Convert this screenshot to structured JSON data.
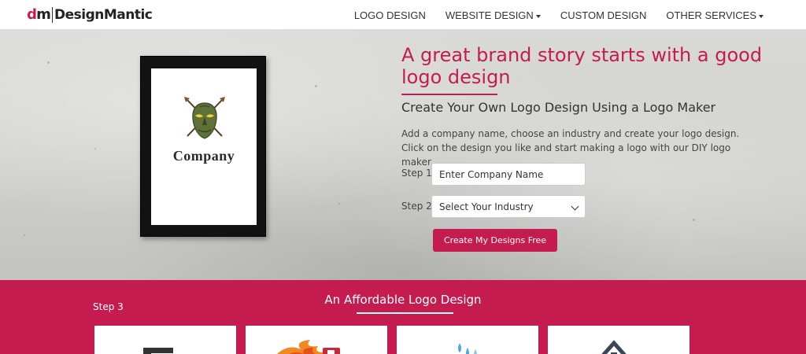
{
  "brand": {
    "mark_d": "d",
    "mark_m": "m",
    "name": "DesignMantic",
    "accent_color": "#c41c4e"
  },
  "nav": {
    "items": [
      {
        "label": "LOGO DESIGN",
        "dropdown": false
      },
      {
        "label": "WEBSITE DESIGN",
        "dropdown": true
      },
      {
        "label": "CUSTOM DESIGN",
        "dropdown": false
      },
      {
        "label": "OTHER SERVICES",
        "dropdown": true
      }
    ]
  },
  "hero": {
    "title": "A great brand story starts with a good logo design",
    "subtitle": "Create Your Own Logo Design Using a Logo Maker",
    "description": "Add a company name, choose an industry and create your logo design. Click on the design you like and start making a logo with our DIY logo maker.",
    "frame_logo_text": "Company",
    "step1_label": "Step 1",
    "company_placeholder": "Enter Company Name",
    "step2_label": "Step 2",
    "industry_selected": "Select Your Industry",
    "cta_label": "Create My Designs Free"
  },
  "band": {
    "step_label": "Step 3",
    "title": "An Affordable Logo Design"
  },
  "cards": [
    {
      "icon": "block-logo-icon"
    },
    {
      "icon": "flame-truck-logo-icon"
    },
    {
      "icon": "water-drops-logo-icon"
    },
    {
      "icon": "house-roof-logo-icon"
    }
  ]
}
